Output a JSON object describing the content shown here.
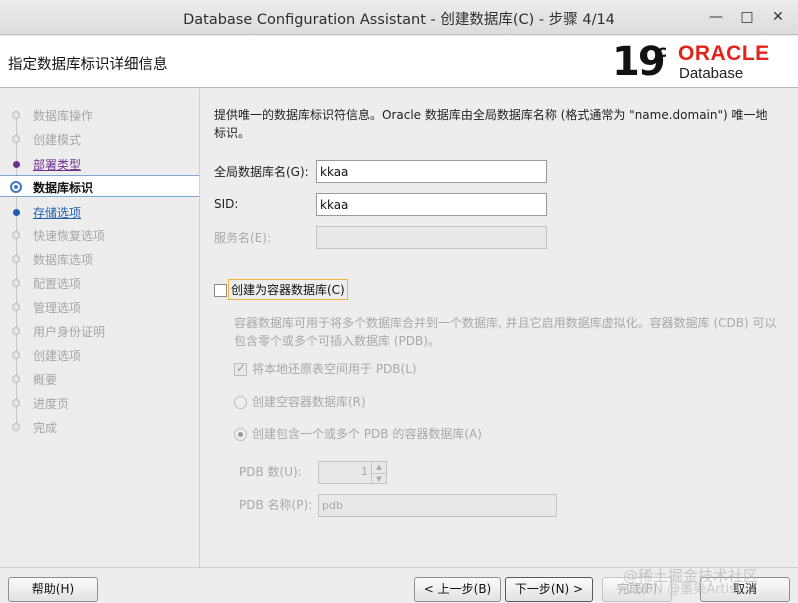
{
  "window": {
    "title": "Database Configuration Assistant - 创建数据库(C) - 步骤 4/14",
    "minimize_icon": "minimize-icon",
    "maximize_icon": "maximize-icon",
    "close_icon": "close-icon"
  },
  "header": {
    "page_title": "指定数据库标识详细信息",
    "logo_version": "19",
    "logo_suffix": "c",
    "logo_brand": "ORACLE",
    "logo_product": "Database"
  },
  "nav": {
    "items": [
      {
        "label": "数据库操作",
        "state": "disabled"
      },
      {
        "label": "创建模式",
        "state": "disabled"
      },
      {
        "label": "部署类型",
        "state": "visited"
      },
      {
        "label": "数据库标识",
        "state": "current"
      },
      {
        "label": "存储选项",
        "state": "link"
      },
      {
        "label": "快速恢复选项",
        "state": "disabled"
      },
      {
        "label": "数据库选项",
        "state": "disabled"
      },
      {
        "label": "配置选项",
        "state": "disabled"
      },
      {
        "label": "管理选项",
        "state": "disabled"
      },
      {
        "label": "用户身份证明",
        "state": "disabled"
      },
      {
        "label": "创建选项",
        "state": "disabled"
      },
      {
        "label": "概要",
        "state": "disabled"
      },
      {
        "label": "进度页",
        "state": "disabled"
      },
      {
        "label": "完成",
        "state": "disabled"
      }
    ]
  },
  "main": {
    "description": "提供唯一的数据库标识符信息。Oracle 数据库由全局数据库名称 (格式通常为 \"name.domain\") 唯一地标识。",
    "global_db_name_label": "全局数据库名(G):",
    "global_db_name_value": "kkaa",
    "sid_label": "SID:",
    "sid_value": "kkaa",
    "service_name_label": "服务名(E):",
    "service_name_value": "",
    "create_cdb_label": "创建为容器数据库(C)",
    "create_cdb_checked": false,
    "cdb_description": "容器数据库可用于将多个数据库合并到一个数据库, 并且它启用数据库虚拟化。容器数据库 (CDB) 可以包含零个或多个可插入数据库 (PDB)。",
    "local_undo_label": "将本地还原表空间用于 PDB(L)",
    "empty_cdb_label": "创建空容器数据库(R)",
    "with_pdb_label": "创建包含一个或多个 PDB 的容器数据库(A)",
    "pdb_count_label": "PDB 数(U):",
    "pdb_count_value": "1",
    "pdb_name_label": "PDB 名称(P):",
    "pdb_name_value": "pdb"
  },
  "footer": {
    "help_label": "帮助(H)",
    "back_label": "< 上一步(B)",
    "next_label": "下一步(N) >",
    "finish_label": "完成(F)",
    "cancel_label": "取消"
  },
  "watermark": {
    "line1": "@稀土掘金技术社区",
    "line2": "CSDN @墨染Artist"
  }
}
